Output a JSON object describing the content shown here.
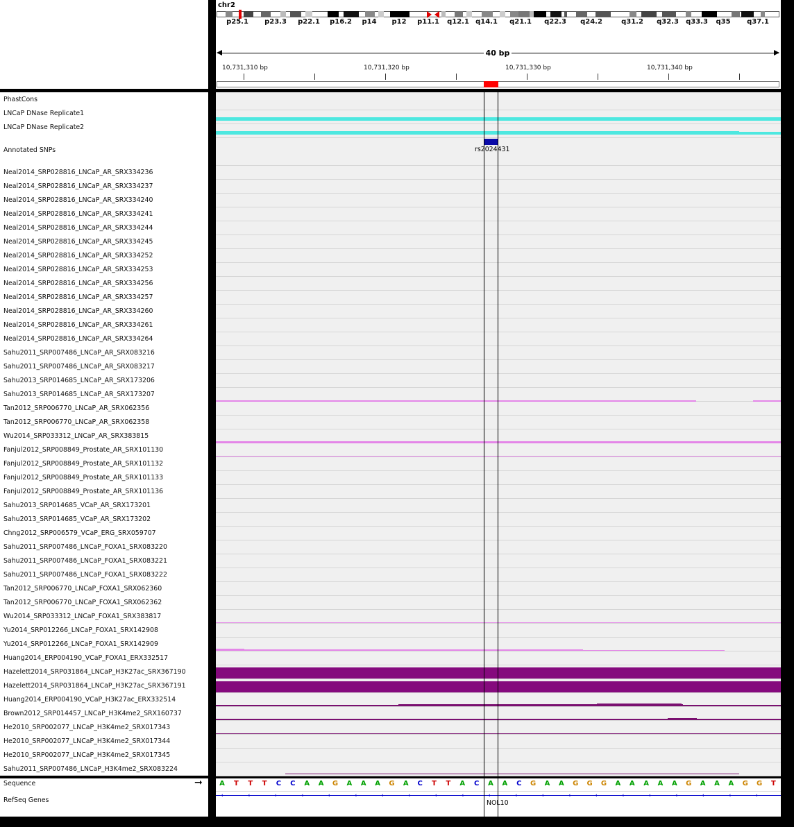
{
  "ideogram": {
    "chromosome": "chr2",
    "bands": [
      "p25.1",
      "p23.3",
      "p22.1",
      "p16.2",
      "p14",
      "p12",
      "p11.1",
      "q12.1",
      "q14.1",
      "q21.1",
      "q22.3",
      "q24.2",
      "q31.2",
      "q32.3",
      "q33.3",
      "q35",
      "q37.1"
    ]
  },
  "ruler": {
    "span_label": "40 bp",
    "positions": [
      "10,731,310 bp",
      "10,731,320 bp",
      "10,731,330 bp",
      "10,731,340 bp"
    ]
  },
  "tracks": {
    "phastcons": "PhastCons",
    "dnase1": "LNCaP DNase Replicate1",
    "dnase2": "LNCaP DNase Replicate2",
    "snps": "Annotated SNPs",
    "chip": [
      "Neal2014_SRP028816_LNCaP_AR_SRX334236",
      "Neal2014_SRP028816_LNCaP_AR_SRX334237",
      "Neal2014_SRP028816_LNCaP_AR_SRX334240",
      "Neal2014_SRP028816_LNCaP_AR_SRX334241",
      "Neal2014_SRP028816_LNCaP_AR_SRX334244",
      "Neal2014_SRP028816_LNCaP_AR_SRX334245",
      "Neal2014_SRP028816_LNCaP_AR_SRX334252",
      "Neal2014_SRP028816_LNCaP_AR_SRX334253",
      "Neal2014_SRP028816_LNCaP_AR_SRX334256",
      "Neal2014_SRP028816_LNCaP_AR_SRX334257",
      "Neal2014_SRP028816_LNCaP_AR_SRX334260",
      "Neal2014_SRP028816_LNCaP_AR_SRX334261",
      "Neal2014_SRP028816_LNCaP_AR_SRX334264",
      "Sahu2011_SRP007486_LNCaP_AR_SRX083216",
      "Sahu2011_SRP007486_LNCaP_AR_SRX083217",
      "Sahu2013_SRP014685_LNCaP_AR_SRX173206",
      "Sahu2013_SRP014685_LNCaP_AR_SRX173207",
      "Tan2012_SRP006770_LNCaP_AR_SRX062356",
      "Tan2012_SRP006770_LNCaP_AR_SRX062358",
      "Wu2014_SRP033312_LNCaP_AR_SRX383815",
      "Fanjul2012_SRP008849_Prostate_AR_SRX101130",
      "Fanjul2012_SRP008849_Prostate_AR_SRX101132",
      "Fanjul2012_SRP008849_Prostate_AR_SRX101133",
      "Fanjul2012_SRP008849_Prostate_AR_SRX101136",
      "Sahu2013_SRP014685_VCaP_AR_SRX173201",
      "Sahu2013_SRP014685_VCaP_AR_SRX173202",
      "Chng2012_SRP006579_VCaP_ERG_SRX059707",
      "Sahu2011_SRP007486_LNCaP_FOXA1_SRX083220",
      "Sahu2011_SRP007486_LNCaP_FOXA1_SRX083221",
      "Sahu2011_SRP007486_LNCaP_FOXA1_SRX083222",
      "Tan2012_SRP006770_LNCaP_FOXA1_SRX062360",
      "Tan2012_SRP006770_LNCaP_FOXA1_SRX062362",
      "Wu2014_SRP033312_LNCaP_FOXA1_SRX383817",
      "Yu2014_SRP012266_LNCaP_FOXA1_SRX142908",
      "Yu2014_SRP012266_LNCaP_FOXA1_SRX142909",
      "Huang2014_ERP004190_VCaP_FOXA1_ERX332517",
      "Hazelett2014_SRP031864_LNCaP_H3K27ac_SRX367190",
      "Hazelett2014_SRP031864_LNCaP_H3K27ac_SRX367191",
      "Huang2014_ERP004190_VCaP_H3K27ac_ERX332514",
      "Brown2012_SRP014457_LNCaP_H3K4me2_SRX160737",
      "He2010_SRP002077_LNCaP_H3K4me2_SRX017343",
      "He2010_SRP002077_LNCaP_H3K4me2_SRX017344",
      "He2010_SRP002077_LNCaP_H3K4me2_SRX017345",
      "Sahu2011_SRP007486_LNCaP_H3K4me2_SRX083224"
    ],
    "sequence": "Sequence",
    "refseq": "RefSeq Genes"
  },
  "snp_name": "rs2024431",
  "gene_name": "NOL10",
  "sequence_bases": [
    "A",
    "T",
    "T",
    "T",
    "C",
    "C",
    "A",
    "A",
    "G",
    "A",
    "A",
    "A",
    "G",
    "A",
    "C",
    "T",
    "T",
    "A",
    "C",
    "A",
    "A",
    "C",
    "G",
    "A",
    "A",
    "G",
    "G",
    "G",
    "A",
    "A",
    "A",
    "A",
    "A",
    "G",
    "A",
    "A",
    "A",
    "G",
    "G",
    "T"
  ],
  "colors": {
    "dnase": "#4de8e0",
    "chip_ar": "#e486e8",
    "h3k27ac": "#850a7d",
    "h3k4me2": "#7a1070",
    "snp": "#0a0aa8",
    "base_A": "#00a000",
    "base_C": "#0000cc",
    "base_G": "#cc8400",
    "base_T": "#cc0000"
  }
}
